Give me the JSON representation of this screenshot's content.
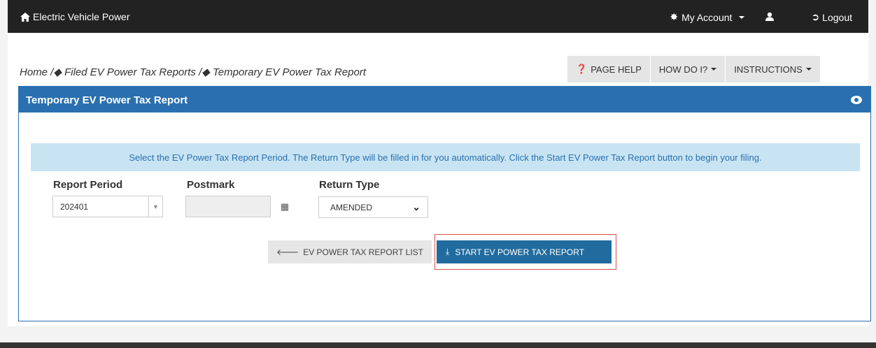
{
  "nav": {
    "brand": "Electric Vehicle Power",
    "account": "My Account",
    "logout": "Logout"
  },
  "breadcrumb": "Home /\u0000 Filed EV Power Tax Reports /\u0000 Temporary EV Power Tax Report",
  "breadcrumb_parts": [
    "Home /",
    "Filed EV Power Tax Reports /",
    "Temporary EV Power Tax Report"
  ],
  "help": {
    "page_help": "PAGE HELP",
    "how_do_i": "HOW DO I?",
    "instructions": "INSTRUCTIONS"
  },
  "panel": {
    "title": "Temporary EV Power Tax Report",
    "info": "Select the EV Power Tax Report Period. The Return Type will be filled in for you automatically. Click the Start EV Power Tax Report button to begin your filing."
  },
  "form": {
    "report_period_label": "Report Period",
    "report_period_value": "202401",
    "postmark_label": "Postmark",
    "postmark_value": "",
    "return_type_label": "Return Type",
    "return_type_value": "AMENDED"
  },
  "buttons": {
    "list": "EV POWER TAX REPORT LIST",
    "start": "START EV POWER TAX REPORT"
  }
}
